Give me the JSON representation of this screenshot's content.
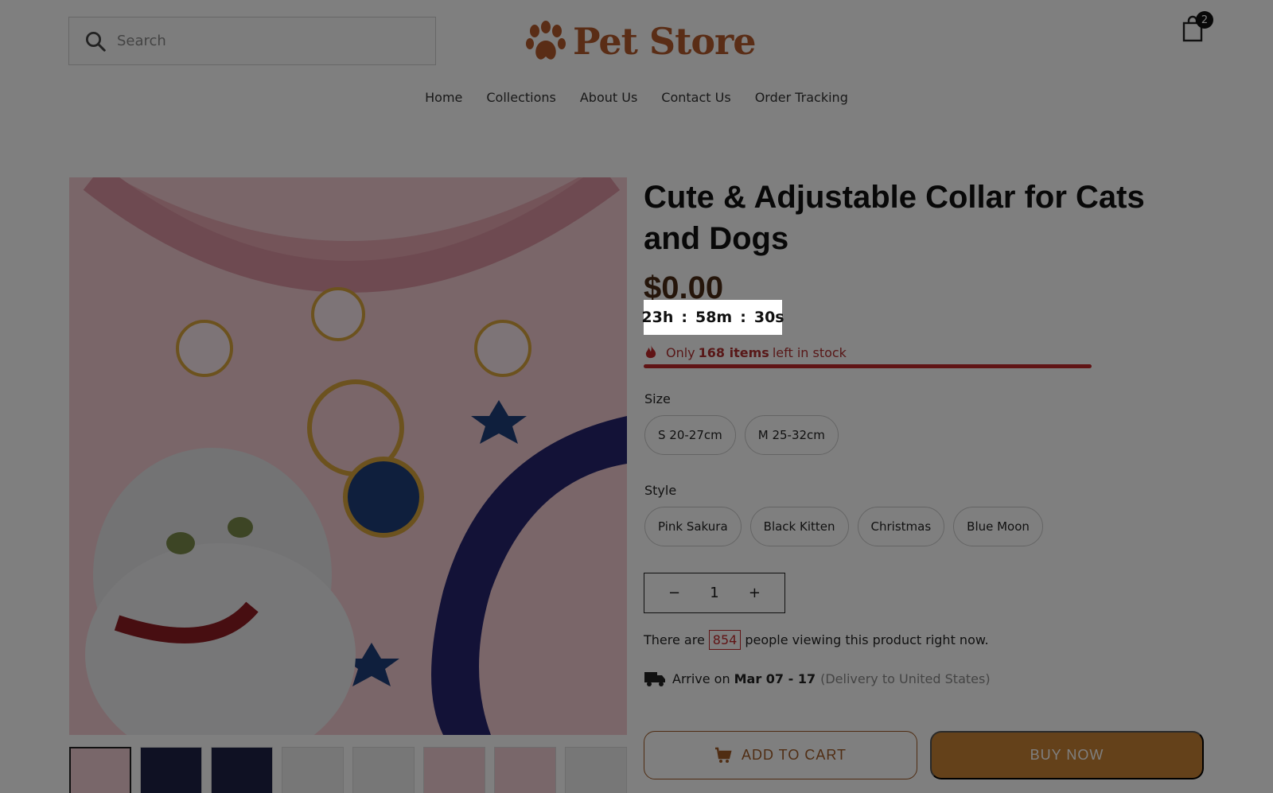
{
  "header": {
    "search_placeholder": "Search",
    "logo_text": "Pet Store",
    "cart_count": "2"
  },
  "nav": [
    {
      "label": "Home"
    },
    {
      "label": "Collections"
    },
    {
      "label": "About Us"
    },
    {
      "label": "Contact Us"
    },
    {
      "label": "Order Tracking"
    }
  ],
  "product": {
    "title": "Cute & Adjustable Collar for Cats and Dogs",
    "price": "$0.00",
    "timer": {
      "hours": "23h",
      "minutes": "58m",
      "seconds": "30s",
      "sep": ":"
    },
    "stock": {
      "prefix": "Only",
      "count": "168 items",
      "suffix": "left in stock",
      "level": 1.0
    },
    "size": {
      "label": "Size",
      "options": [
        "S 20-27cm",
        "M 25-32cm"
      ]
    },
    "style": {
      "label": "Style",
      "options": [
        "Pink Sakura",
        "Black Kitten",
        "Christmas",
        "Blue Moon"
      ]
    },
    "quantity": {
      "minus": "−",
      "value": "1",
      "plus": "+"
    },
    "viewers": {
      "prefix": "There are",
      "count": "854",
      "suffix": "people viewing this product right now."
    },
    "delivery": {
      "prefix": "Arrive on",
      "dates": "Mar 07 - 17",
      "note": "(Delivery to United States)"
    },
    "add_to_cart": "ADD TO CART",
    "buy_now": "BUY NOW"
  },
  "colors": {
    "brand": "#b55a2c",
    "accent": "#c98234",
    "stock_red": "#c0282b",
    "overlay": "rgba(0,0,0,0.5)"
  },
  "icons": {
    "search": "search-icon",
    "cart": "shopping-bag-icon",
    "logo": "paw-icon",
    "stock": "flame-icon",
    "delivery": "truck-icon",
    "add_to_cart": "cart-icon"
  }
}
